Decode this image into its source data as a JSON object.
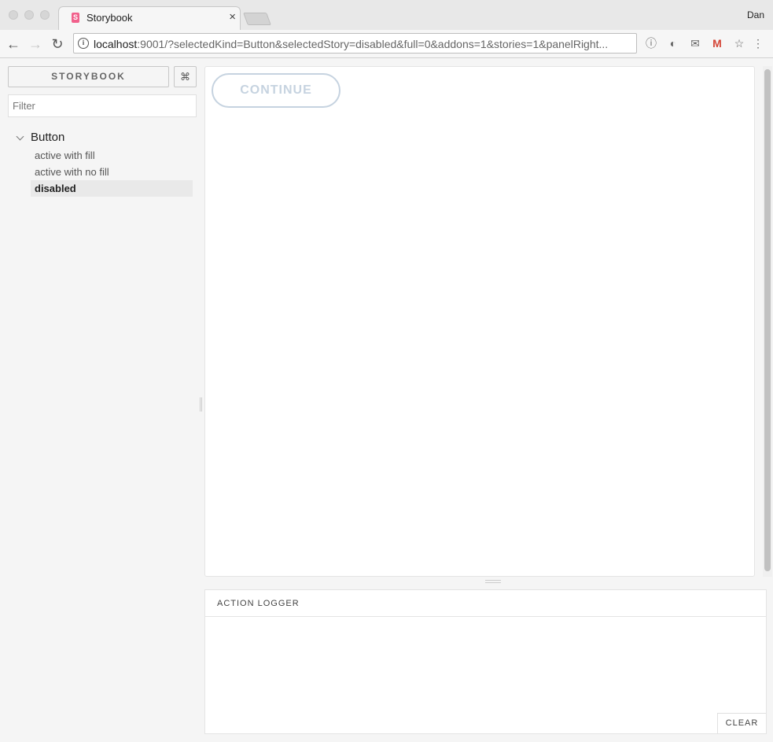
{
  "browser": {
    "tab_title": "Storybook",
    "favicon_letter": "S",
    "tab_close": "×",
    "user_name": "Dan",
    "url_host": "localhost",
    "url_rest": ":9001/?selectedKind=Button&selectedStory=disabled&full=0&addons=1&stories=1&panelRight...",
    "nav": {
      "back": "←",
      "forward": "→",
      "reload": "↻"
    },
    "extensions": [
      "ⓘ",
      "◐",
      "✉",
      "M",
      "☆",
      "⋮"
    ]
  },
  "sidebar": {
    "title": "STORYBOOK",
    "shortcut": "⌘",
    "filter_placeholder": "Filter",
    "kind": "Button",
    "stories": [
      {
        "label": "active with fill",
        "selected": false
      },
      {
        "label": "active with no fill",
        "selected": false
      },
      {
        "label": "disabled",
        "selected": true
      }
    ]
  },
  "preview": {
    "button_label": "CONTINUE"
  },
  "logger": {
    "title": "ACTION LOGGER",
    "clear_label": "CLEAR"
  },
  "colors": {
    "disabled_button": "#c6d3e0",
    "favicon": "#f1618c"
  }
}
